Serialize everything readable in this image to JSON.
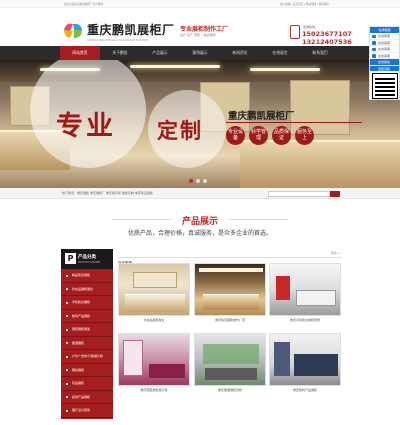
{
  "topbar": {
    "welcome": "欢迎光临重庆鹏凯展柜厂官方网站",
    "links": "加入收藏 | 设为首页 | 网站地图 | 联系我们"
  },
  "header": {
    "brand": "重庆鹏凯展柜厂",
    "brand_en": "CHONGQING PENGKAI SHOWCASE FACTORY",
    "slogan_main": "专业展柜制作工厂",
    "slogan_sub": "设计 生产 安装 一站式服务",
    "hotline_label": "咨询热线：",
    "phone1": "15023677107",
    "phone2": "13212407536"
  },
  "nav": {
    "items": [
      "网站首页",
      "关于鹏凯",
      "产品展示",
      "案例展示",
      "新闻资讯",
      "在线留言",
      "联系我们"
    ]
  },
  "hero": {
    "big_text_1": "专业",
    "big_text_2": "定制",
    "company": "重庆鹏凯展柜厂",
    "badges": [
      "专业设备",
      "科学管理",
      "品质保证",
      "服务至上"
    ]
  },
  "side_tools": {
    "title": "在线客服",
    "rows": [
      "在线客服",
      "在线客服",
      "在线客服",
      "在线客服",
      "在线留言",
      "返回顶部"
    ],
    "qr_label": "扫一扫关注"
  },
  "searchbar": {
    "hot": "热门搜索：重庆展柜  重庆展柜厂  重庆展示柜  展柜定制  重庆珠宝展柜"
  },
  "section": {
    "title": "产品展示",
    "subtitle": "优质产品，合理价格，真诚服务，是众多企业的首选。"
  },
  "categories": {
    "letter": "P",
    "title": "产品分类",
    "title_en": "PRODUCT CENTER",
    "items": [
      "精品珠宝展柜",
      "化妆品展柜展台",
      "手机柜台展柜",
      "数码产品展柜",
      "服装展柜展架",
      "烟酒展柜",
      "户外广告牌/灯箱展示柜",
      "眼镜展柜",
      "药品展柜",
      "其他产品展柜",
      "展厅设计装修"
    ]
  },
  "products": {
    "header": "新品推荐",
    "more": "更多>>",
    "items": [
      {
        "caption": "化妆品展柜展台"
      },
      {
        "caption": "重庆珠宝展柜制作厂家"
      },
      {
        "caption": "重庆手机柜台展柜定制"
      },
      {
        "caption": "重庆服装展柜展示架"
      },
      {
        "caption": "重庆烟酒展柜定制"
      },
      {
        "caption": "重庆数码产品展柜"
      }
    ]
  },
  "colors": {
    "brand_red": "#a61d1d",
    "nav_dark": "#2b2b2b"
  }
}
